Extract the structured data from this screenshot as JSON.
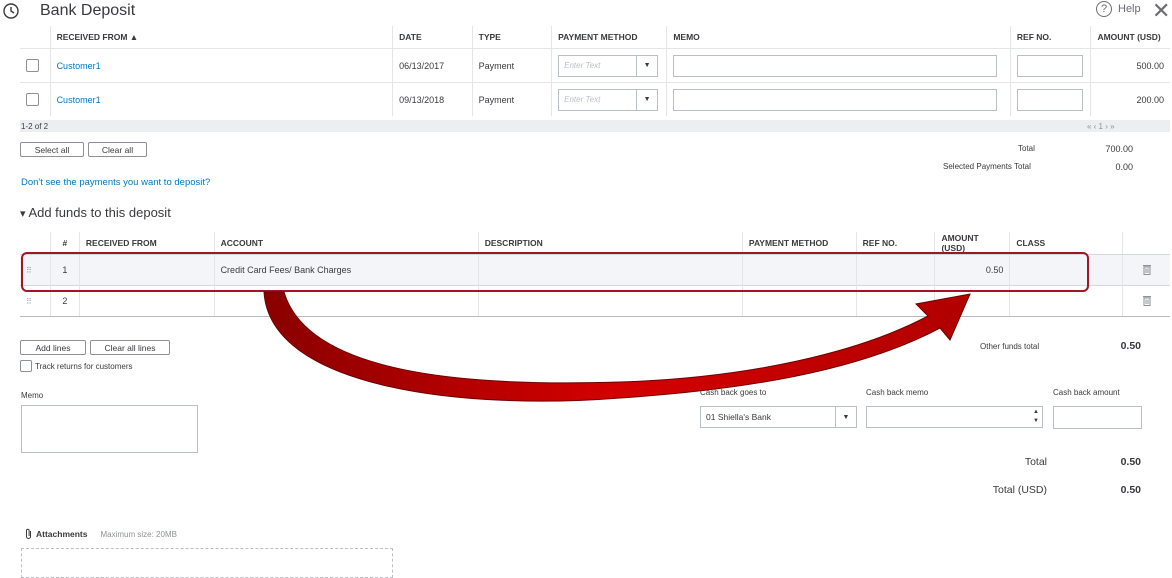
{
  "header": {
    "title": "Bank Deposit",
    "help_label": "Help",
    "help_icon": "?",
    "close_icon": "✕"
  },
  "payments": {
    "columns": [
      "RECEIVED FROM ▲",
      "DATE",
      "TYPE",
      "PAYMENT METHOD",
      "MEMO",
      "REF NO.",
      "AMOUNT (USD)"
    ],
    "rows": [
      {
        "received_from": "Customer1",
        "date": "06/13/2017",
        "type": "Payment",
        "method_placeholder": "Enter Text",
        "amount": "500.00"
      },
      {
        "received_from": "Customer1",
        "date": "09/13/2018",
        "type": "Payment",
        "method_placeholder": "Enter Text",
        "amount": "200.00"
      }
    ],
    "pagination_count": "1-2 of 2",
    "pager": "« ‹ 1 › »",
    "select_all": "Select all",
    "clear_all": "Clear all",
    "total_label": "Total",
    "total_value": "700.00",
    "selected_label": "Selected Payments Total",
    "selected_value": "0.00",
    "missing_link": "Don't see the payments you want to deposit?"
  },
  "funds": {
    "toggle_icon": "▾",
    "title": "Add funds to this deposit",
    "columns": [
      "#",
      "RECEIVED FROM",
      "ACCOUNT",
      "DESCRIPTION",
      "PAYMENT METHOD",
      "REF NO.",
      "AMOUNT (USD)",
      "CLASS"
    ],
    "rows": [
      {
        "num": "1",
        "account": "Credit Card Fees/ Bank Charges",
        "amount": "0.50"
      },
      {
        "num": "2",
        "account": "",
        "amount": ""
      }
    ],
    "add_lines": "Add lines",
    "clear_all_lines": "Clear all lines",
    "track_returns": "Track returns for customers",
    "other_total_label": "Other funds total",
    "other_total_value": "0.50"
  },
  "memo_label": "Memo",
  "cash_back": {
    "goes_to_label": "Cash back goes to",
    "goes_to_value": "01 Shiella's Bank",
    "memo_label": "Cash back memo",
    "amount_label": "Cash back amount"
  },
  "totals": {
    "total_label": "Total",
    "total_value": "0.50",
    "total_usd_label": "Total (USD)",
    "total_usd_value": "0.50"
  },
  "attachments": {
    "label": "Attachments",
    "max_size": "Maximum size: 20MB"
  },
  "colors": {
    "link": "#0077c5",
    "highlight_border": "#a01624",
    "arrow": "#c00000"
  }
}
